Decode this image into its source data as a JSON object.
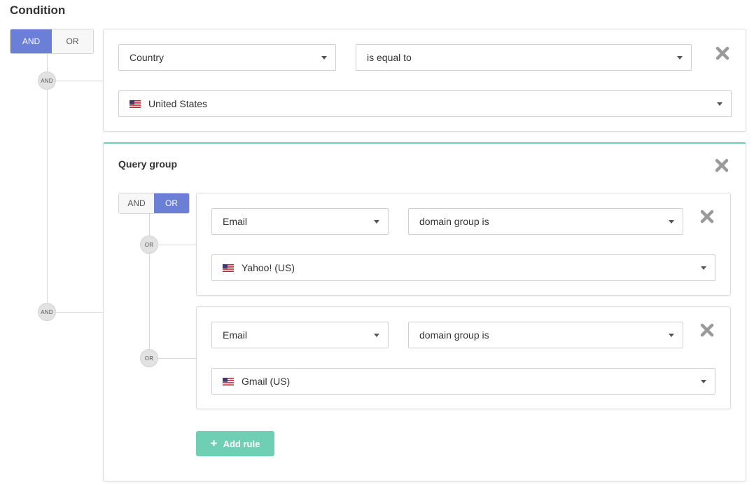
{
  "title": "Condition",
  "root_toggle": {
    "and": "AND",
    "or": "OR",
    "active": "AND"
  },
  "root_badges": [
    "AND",
    "AND"
  ],
  "rule1": {
    "field": "Country",
    "operator": "is equal to",
    "value": "United States",
    "value_icon": "us-flag-icon"
  },
  "group": {
    "title": "Query group",
    "toggle": {
      "and": "AND",
      "or": "OR",
      "active": "OR"
    },
    "badges": [
      "OR",
      "OR"
    ],
    "rules": [
      {
        "field": "Email",
        "operator": "domain group is",
        "value": "Yahoo! (US)",
        "value_icon": "us-flag-icon"
      },
      {
        "field": "Email",
        "operator": "domain group is",
        "value": "Gmail (US)",
        "value_icon": "us-flag-icon"
      }
    ],
    "add_rule_label": "Add rule"
  },
  "colors": {
    "accent": "#6b7fd7",
    "group_border": "#6fcfb4",
    "add_button": "#6fcfb4"
  }
}
